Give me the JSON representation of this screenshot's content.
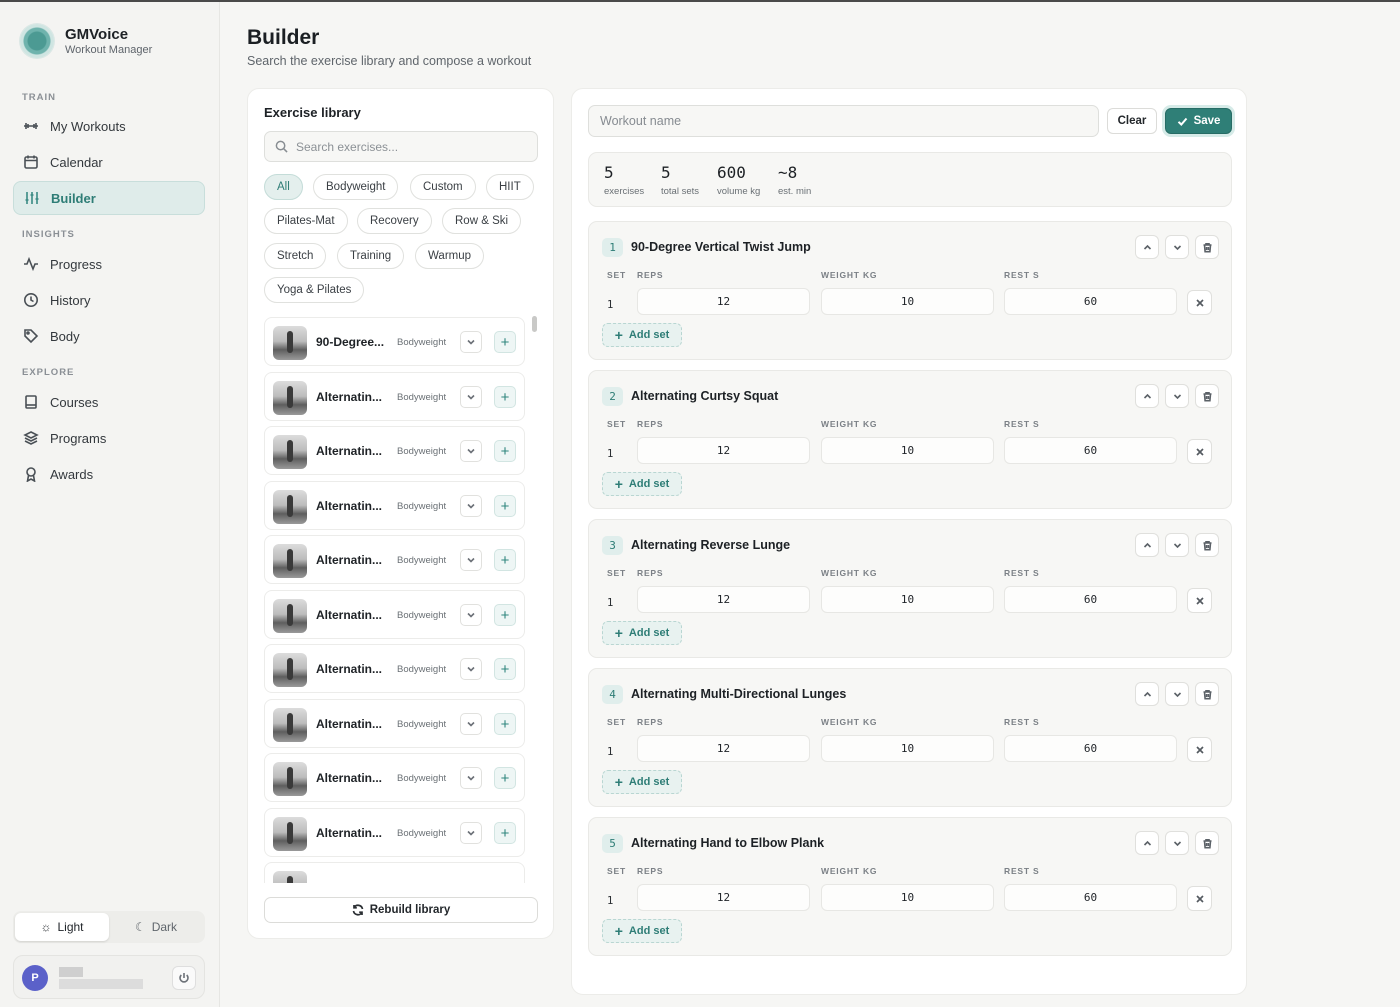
{
  "app": {
    "name": "GMVoice",
    "subtitle": "Workout Manager"
  },
  "sidebar": {
    "sections": [
      {
        "label": "TRAIN",
        "items": [
          {
            "label": "My Workouts",
            "icon": "dumbbell-icon"
          },
          {
            "label": "Calendar",
            "icon": "calendar-icon"
          },
          {
            "label": "Builder",
            "icon": "sliders-icon",
            "active": true
          }
        ]
      },
      {
        "label": "INSIGHTS",
        "items": [
          {
            "label": "Progress",
            "icon": "activity-icon"
          },
          {
            "label": "History",
            "icon": "clock-icon"
          },
          {
            "label": "Body",
            "icon": "tag-icon"
          }
        ]
      },
      {
        "label": "EXPLORE",
        "items": [
          {
            "label": "Courses",
            "icon": "book-icon"
          },
          {
            "label": "Programs",
            "icon": "layers-icon"
          },
          {
            "label": "Awards",
            "icon": "award-icon"
          }
        ]
      }
    ],
    "theme": {
      "light": "Light",
      "dark": "Dark",
      "selected": "light"
    },
    "user": {
      "initial": "P"
    }
  },
  "header": {
    "title": "Builder",
    "subtitle": "Search the exercise library and compose a workout"
  },
  "library": {
    "title": "Exercise library",
    "search_placeholder": "Search exercises...",
    "filters": [
      "All",
      "Bodyweight",
      "Custom",
      "HIIT",
      "Pilates-Mat",
      "Recovery",
      "Row & Ski",
      "Stretch",
      "Training",
      "Warmup",
      "Yoga & Pilates"
    ],
    "active_filter": "All",
    "items": [
      {
        "name": "90-Degree...",
        "category": "Bodyweight"
      },
      {
        "name": "Alternatin...",
        "category": "Bodyweight"
      },
      {
        "name": "Alternatin...",
        "category": "Bodyweight"
      },
      {
        "name": "Alternatin...",
        "category": "Bodyweight"
      },
      {
        "name": "Alternatin...",
        "category": "Bodyweight"
      },
      {
        "name": "Alternatin...",
        "category": "Bodyweight"
      },
      {
        "name": "Alternatin...",
        "category": "Bodyweight"
      },
      {
        "name": "Alternatin...",
        "category": "Bodyweight"
      },
      {
        "name": "Alternatin...",
        "category": "Bodyweight"
      },
      {
        "name": "Alternatin...",
        "category": "Bodyweight"
      }
    ],
    "rebuild_label": "Rebuild library"
  },
  "workout": {
    "name_placeholder": "Workout name",
    "clear_label": "Clear",
    "save_label": "Save",
    "stats": [
      {
        "value": "5",
        "label": "exercises"
      },
      {
        "value": "5",
        "label": "total sets"
      },
      {
        "value": "600",
        "label": "volume kg"
      },
      {
        "value": "~8",
        "label": "est. min"
      }
    ],
    "columns": {
      "set": "SET",
      "reps": "REPS",
      "weight": "WEIGHT KG",
      "rest": "REST S"
    },
    "add_set_label": "Add set",
    "exercises": [
      {
        "num": "1",
        "name": "90-Degree Vertical Twist Jump",
        "sets": [
          {
            "set": "1",
            "reps": "12",
            "weight": "10",
            "rest": "60"
          }
        ]
      },
      {
        "num": "2",
        "name": "Alternating Curtsy Squat",
        "sets": [
          {
            "set": "1",
            "reps": "12",
            "weight": "10",
            "rest": "60"
          }
        ]
      },
      {
        "num": "3",
        "name": "Alternating Reverse Lunge",
        "sets": [
          {
            "set": "1",
            "reps": "12",
            "weight": "10",
            "rest": "60"
          }
        ]
      },
      {
        "num": "4",
        "name": "Alternating Multi-Directional Lunges",
        "sets": [
          {
            "set": "1",
            "reps": "12",
            "weight": "10",
            "rest": "60"
          }
        ]
      },
      {
        "num": "5",
        "name": "Alternating Hand to Elbow Plank",
        "sets": [
          {
            "set": "1",
            "reps": "12",
            "weight": "10",
            "rest": "60"
          }
        ]
      }
    ]
  },
  "colors": {
    "accent": "#2f7f77",
    "accent_soft": "#e4efed",
    "avatar": "#5b61c9"
  }
}
